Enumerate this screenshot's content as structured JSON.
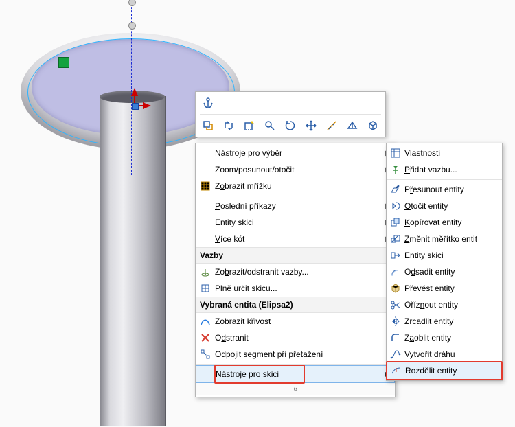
{
  "toolbar_row1": {
    "anchor_icon": "anchor-icon"
  },
  "toolbar_row2": [
    "select-other-icon",
    "flip-relations-icon",
    "new-sketch-icon",
    "zoom-icon",
    "rotate-view-icon",
    "pan-icon",
    "measure-icon",
    "section-icon",
    "view-cube-icon"
  ],
  "menu": {
    "tools_for_select": "Nástroje pro výběr",
    "zoom_pan_rotate": "Zoom/posunout/otočit",
    "show_grid": "Zobrazit mřížku",
    "recent_commands": "Poslední příkazy",
    "sketch_entities": "Entity skici",
    "more_dims": "Více kót",
    "header_relations": "Vazby",
    "show_delete_relations": "Zobrazit/odstranit vazby...",
    "fully_define_sketch": "Plně určit skicu...",
    "header_selected": "Vybraná entita (Elipsa2)",
    "show_curvature": "Zobrazit křivost",
    "delete": "Odstranit",
    "detach_segment": "Odpojit segment při přetažení",
    "sketch_tools": "Nástroje pro skici"
  },
  "submenu": {
    "properties": "Vlastnosti",
    "add_relation": "Přidat vazbu...",
    "move_entities": "Přesunout entity",
    "rotate_entities": "Otočit entity",
    "copy_entities": "Kopírovat entity",
    "scale_entities": "Změnit měřítko entit",
    "sketch_entities": "Entity skici",
    "offset_entities": "Odsadit entity",
    "convert_entities": "Převést entity",
    "trim_entities": "Oříznout entity",
    "mirror_entities": "Zrcadlit entity",
    "fillet_entities": "Zaoblit entity",
    "create_path": "Vytvořit dráhu",
    "split_entities": "Rozdělit entity"
  },
  "chevron": "»"
}
